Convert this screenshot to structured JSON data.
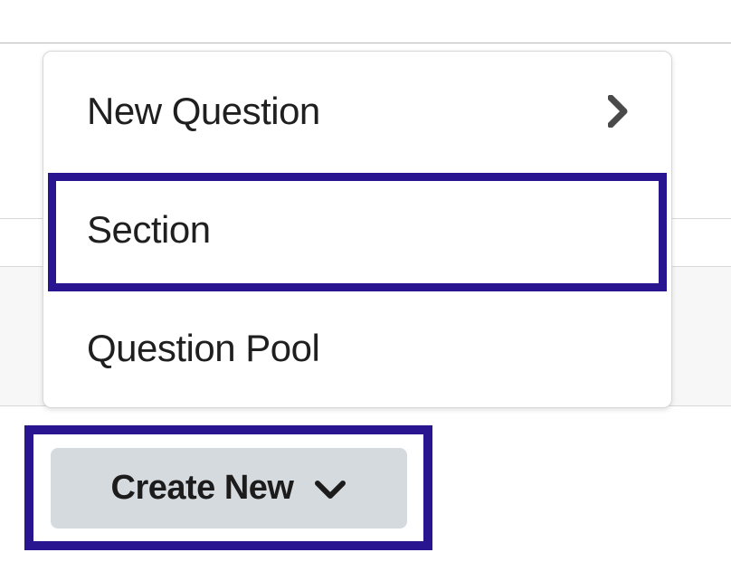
{
  "menu": {
    "items": [
      {
        "label": "New Question",
        "hasChevron": true
      },
      {
        "label": "Section",
        "hasChevron": false
      },
      {
        "label": "Question Pool",
        "hasChevron": false
      }
    ]
  },
  "button": {
    "label": "Create New"
  },
  "highlight": {
    "menuIndex": 1,
    "buttonHighlighted": true
  }
}
